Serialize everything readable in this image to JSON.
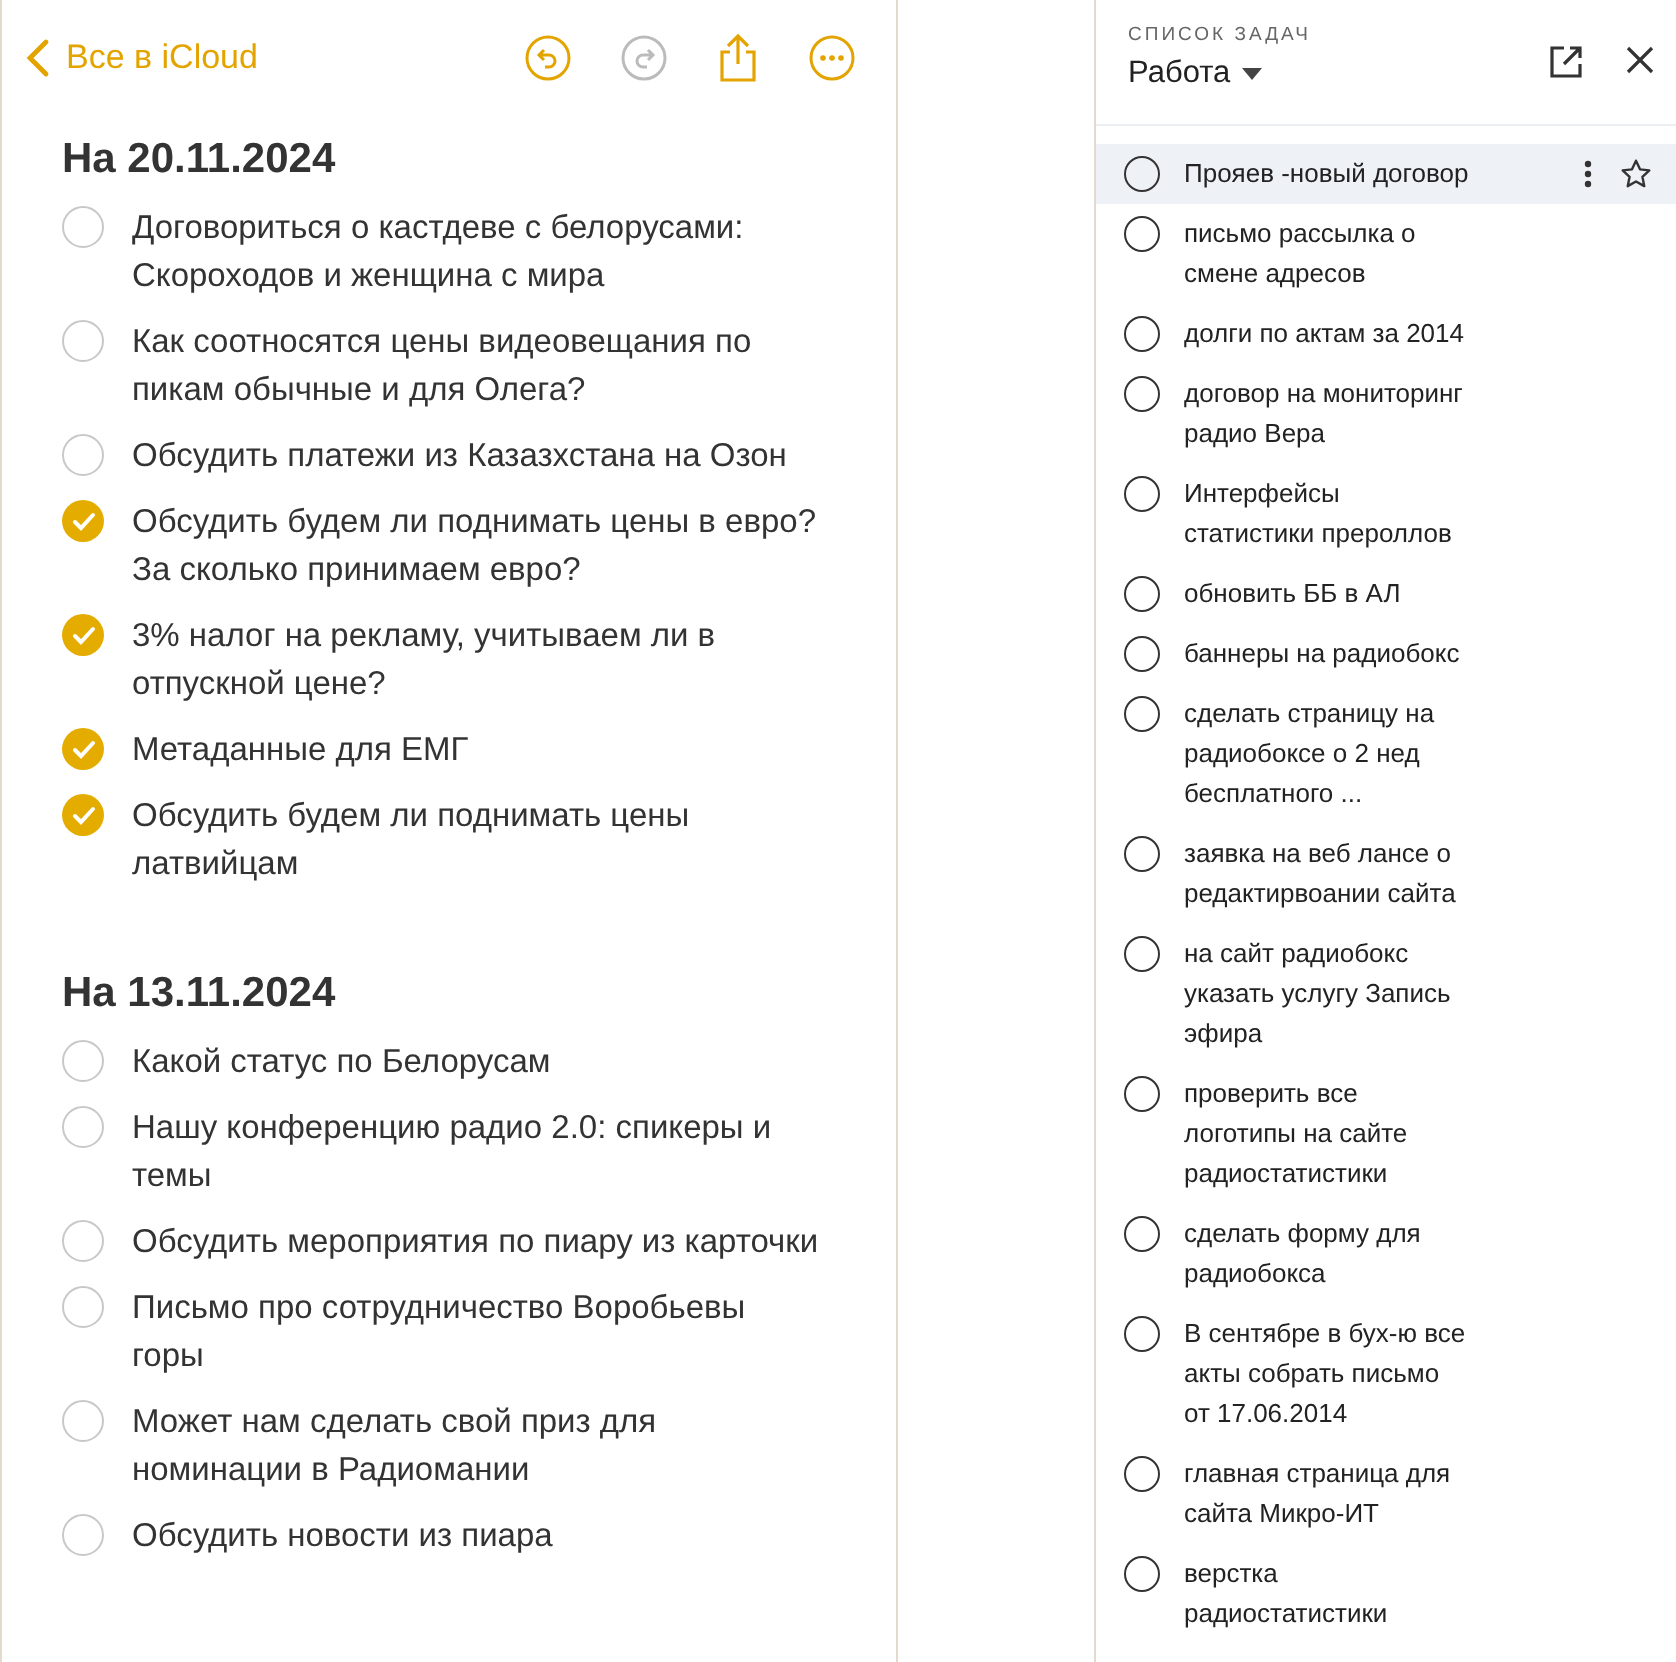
{
  "notes": {
    "back_label": "Все в iCloud",
    "undo_enabled": true,
    "redo_enabled": false,
    "sections": [
      {
        "title": "На 20.11.2024",
        "items": [
          {
            "text": "Договориться о кастдеве с белорусами: Скороходов и женщина с мира",
            "checked": false
          },
          {
            "text": "Как соотносятся цены видеовещания по пикам обычные и для Олега?",
            "checked": false
          },
          {
            "text": "Обсудить платежи из Казазхстана на Озон",
            "checked": false
          },
          {
            "text": "Обсудить будем ли поднимать цены в евро? За сколько принимаем евро?",
            "checked": true
          },
          {
            "text": "3% налог на рекламу, учитываем ли в отпускной цене?",
            "checked": true
          },
          {
            "text": "Метаданные для ЕМГ",
            "checked": true
          },
          {
            "text": "Обсудить будем ли поднимать цены латвийцам",
            "checked": true
          }
        ]
      },
      {
        "title": "На 13.11.2024",
        "items": [
          {
            "text": "Какой статус по Белорусам",
            "checked": false
          },
          {
            "text": "Нашу конференцию радио 2.0: спикеры и темы",
            "checked": false
          },
          {
            "text": "Обсудить мероприятия по пиару из карточки",
            "checked": false
          },
          {
            "text": "Письмо про сотрудничество Воробьевы горы",
            "checked": false
          },
          {
            "text": "Может нам сделать свой приз для номинации в Радиомании",
            "checked": false
          },
          {
            "text": "Обсудить новости из пиара",
            "checked": false
          }
        ]
      }
    ]
  },
  "tasks": {
    "caption": "СПИСОК ЗАДАЧ",
    "list_name": "Работа",
    "items": [
      {
        "text": "Прояев -новый договор",
        "selected": true
      },
      {
        "text": "письмо рассылка о смене адресов",
        "selected": false
      },
      {
        "text": "долги по актам за 2014",
        "selected": false
      },
      {
        "text": "договор на мониторинг радио Вера",
        "selected": false
      },
      {
        "text": "Интерфейсы статистики прероллов",
        "selected": false
      },
      {
        "text": "обновить ББ в АЛ",
        "selected": false
      },
      {
        "text": "баннеры на радиобокс",
        "selected": false
      },
      {
        "text": "сделать страницу на радиобоксе о 2 нед бесплатного ...",
        "selected": false
      },
      {
        "text": "заявка на веб лансе о редактирвоании сайта",
        "selected": false
      },
      {
        "text": "на сайт радиобокс указать услугу Запись эфира",
        "selected": false
      },
      {
        "text": "проверить все логотипы на сайте радиостатистики",
        "selected": false
      },
      {
        "text": "сделать форму для радиобокса",
        "selected": false
      },
      {
        "text": "В сентябре в бух-ю все акты собрать письмо от 17.06.2014",
        "selected": false
      },
      {
        "text": "главная страница для сайта Микро-ИТ",
        "selected": false
      },
      {
        "text": "верстка радиостатистики",
        "selected": false
      }
    ]
  }
}
